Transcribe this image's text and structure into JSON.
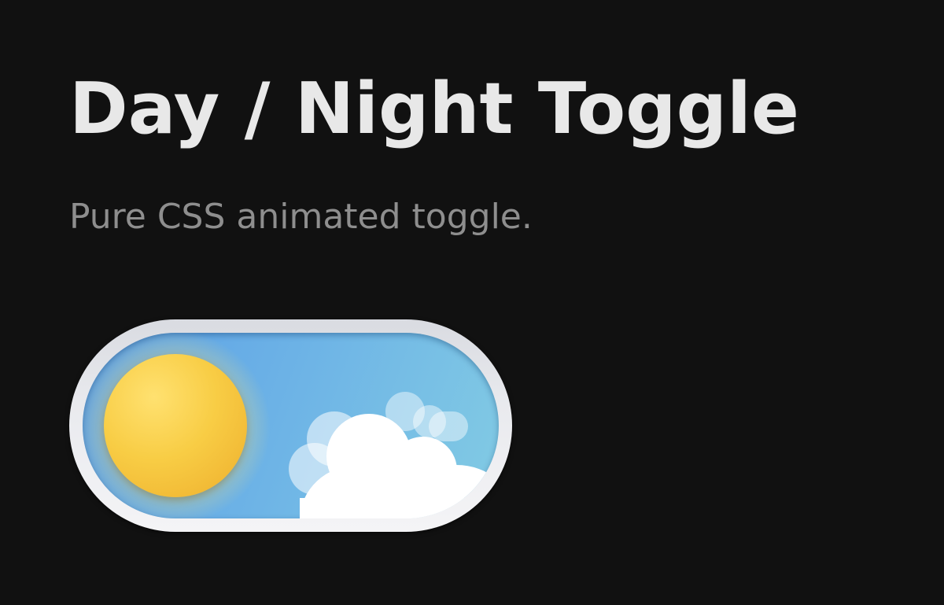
{
  "header": {
    "title": "Day / Night Toggle",
    "subtitle": "Pure CSS animated toggle."
  },
  "toggle": {
    "state": "day",
    "icon": "sun-icon",
    "decoration": "cloud-icon",
    "colors": {
      "sky": "#6cb2e6",
      "sun": "#f8cd45",
      "frame": "#e9eaee",
      "cloud": "#ffffff"
    }
  },
  "colors": {
    "background": "#111111",
    "title": "#e8e8e8",
    "subtitle": "#8e8e8e"
  }
}
